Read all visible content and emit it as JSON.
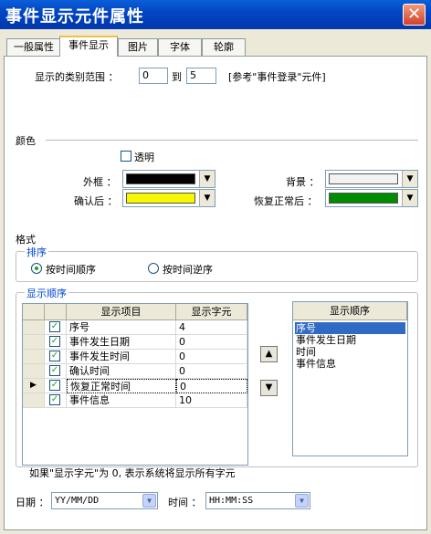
{
  "window": {
    "title": "事件显示元件属性",
    "close": "✕"
  },
  "tabs": [
    "一般属性",
    "事件显示",
    "图片",
    "字体",
    "轮廓"
  ],
  "range": {
    "label": "显示的类别范围 ：",
    "from": "0",
    "to_label": "到",
    "to": "5",
    "hint": "[参考\"事件登录\"元件]"
  },
  "colors": {
    "section": "颜色",
    "transparent_label": "透明",
    "frame_label": "外框 ：",
    "frame_color": "#000000",
    "background_label": "背景 ：",
    "background_color": "#f2f2f2",
    "confirmed_label": "确认后 ：",
    "confirmed_color": "#f7f700",
    "recovered_label": "恢复正常后 ：",
    "recovered_color": "#008c00"
  },
  "format": {
    "section": "格式",
    "sort_group": "排序",
    "sort_asc": "按时间顺序",
    "sort_desc": "按时间逆序",
    "order_group": "显示顺序"
  },
  "grid": {
    "headers": [
      "显示项目",
      "显示字元"
    ],
    "rows": [
      {
        "name": "序号",
        "chars": "4"
      },
      {
        "name": "事件发生日期",
        "chars": "0"
      },
      {
        "name": "事件发生时间",
        "chars": "0"
      },
      {
        "name": "确认时间",
        "chars": "0"
      },
      {
        "name": "恢复正常时间",
        "chars": "0"
      },
      {
        "name": "事件信息",
        "chars": "10"
      }
    ]
  },
  "order_list": {
    "header": "显示顺序",
    "items": [
      "序号",
      "事件发生日期",
      "时间",
      "事件信息"
    ]
  },
  "note": "如果\"显示字元\"为 0, 表示系统将显示所有字元",
  "date": {
    "label": "日期 ：",
    "value": "YY/MM/DD"
  },
  "time": {
    "label": "时间 ：",
    "value": "HH:MM:SS"
  }
}
